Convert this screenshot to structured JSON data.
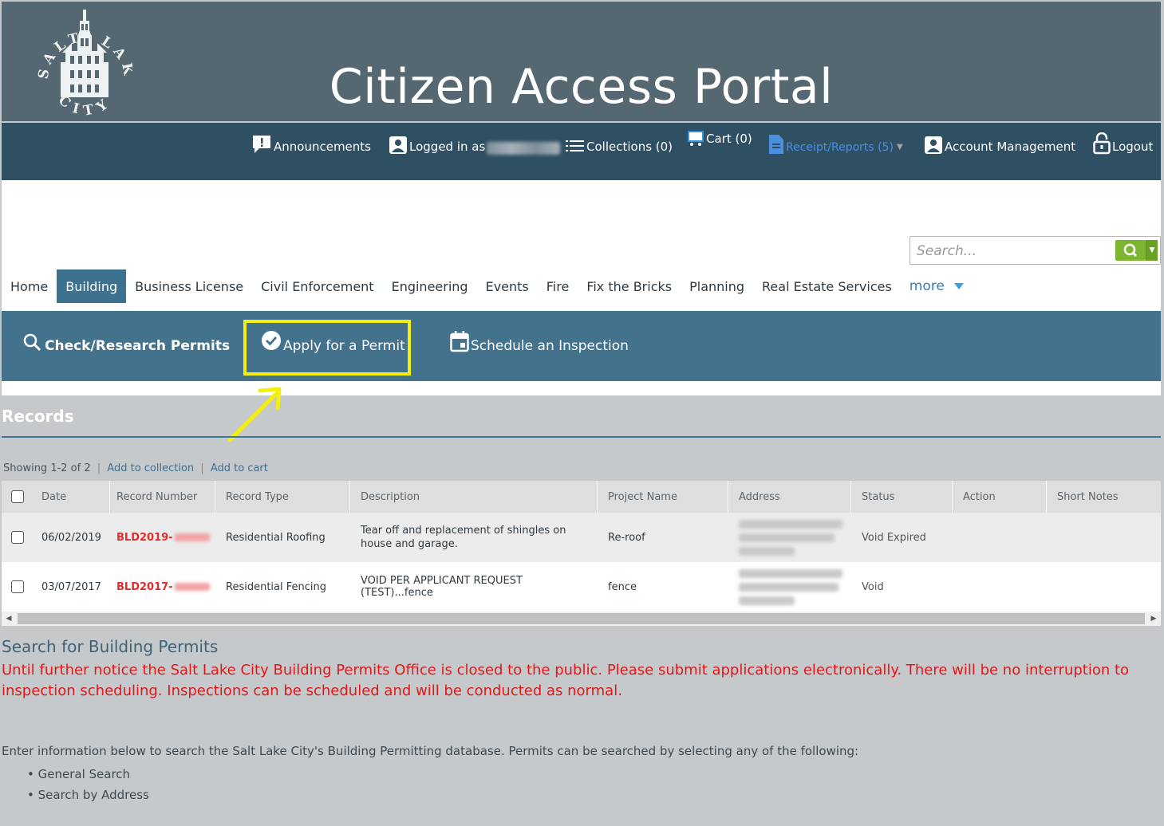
{
  "header": {
    "logo_text": "SALT LAKE CITY",
    "title": "Citizen Access Portal"
  },
  "util_nav": {
    "announcements": "Announcements",
    "logged_in": "Logged in as",
    "collections": "Collections (0)",
    "cart": "Cart (0)",
    "receipts": "Receipt/Reports (5)",
    "account": "Account Management",
    "logout": "Logout"
  },
  "search": {
    "placeholder": "Search..."
  },
  "main_tabs": [
    {
      "label": "Home"
    },
    {
      "label": "Building"
    },
    {
      "label": "Business License"
    },
    {
      "label": "Civil Enforcement"
    },
    {
      "label": "Engineering"
    },
    {
      "label": "Events"
    },
    {
      "label": "Fire"
    },
    {
      "label": "Fix the Bricks"
    },
    {
      "label": "Planning"
    },
    {
      "label": "Real Estate Services"
    },
    {
      "label": "more"
    }
  ],
  "sub_nav": {
    "check": "Check/Research Permits",
    "apply": "Apply for a Permit",
    "schedule": "Schedule an Inspection"
  },
  "records": {
    "title": "Records",
    "showing": "Showing 1-2 of 2",
    "add_collection": "Add to collection",
    "add_cart": "Add to cart",
    "columns": [
      "Date",
      "Record Number",
      "Record Type",
      "Description",
      "Project Name",
      "Address",
      "Status",
      "Action",
      "Short Notes"
    ],
    "rows": [
      {
        "date": "06/02/2019",
        "record_prefix": "BLD2019-",
        "type": "Residential Roofing",
        "description": "Tear off and replacement of shingles on house and garage.",
        "project": "Re-roof",
        "status": "Void Expired"
      },
      {
        "date": "03/07/2017",
        "record_prefix": "BLD2017-",
        "type": "Residential Fencing",
        "description": "VOID PER APPLICANT REQUEST (TEST)...fence",
        "project": "fence",
        "status": "Void"
      }
    ]
  },
  "search_section": {
    "title": "Search for Building Permits",
    "notice": "Until further notice the Salt Lake City Building Permits Office is closed to the public.  Please submit applications electronically. There will be no interruption to inspection scheduling.  Inspections can be scheduled and will be conducted as normal.",
    "intro": "Enter information below to search the Salt Lake City's Building Permitting database. Permits can be searched by selecting any of the following:",
    "bullets": [
      "General Search",
      "Search by Address"
    ]
  },
  "colors": {
    "header_top": "#556872",
    "header_nav": "#2f4f63",
    "sub_nav": "#43728d",
    "active_tab": "#3d7190",
    "highlight": "#f5ee12",
    "notice": "#e31717",
    "search_btn": "#7cb630"
  },
  "icons": {
    "announcements": "exclamation-speech-icon",
    "logged_in": "user-icon",
    "collections": "list-icon",
    "cart": "cart-icon",
    "receipts": "document-icon",
    "account": "user-icon",
    "logout": "lock-icon",
    "search": "magnifier-icon",
    "apply": "check-circle-icon",
    "schedule": "calendar-icon"
  }
}
